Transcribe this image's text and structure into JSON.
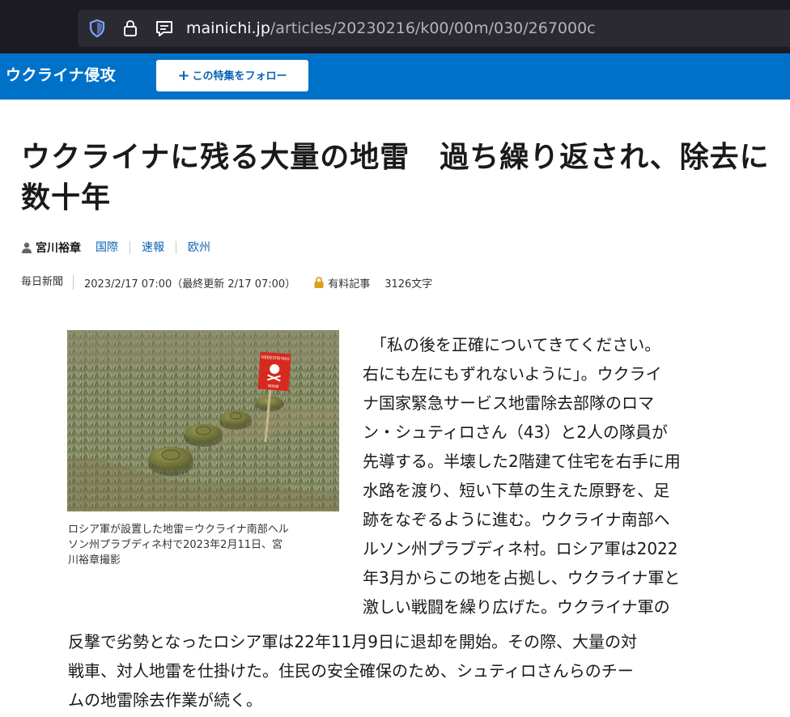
{
  "browser": {
    "url_domain": "mainichi.jp",
    "url_path": "/articles/20230216/k00/00m/030/267000c",
    "icons": [
      "shield-icon",
      "lock-icon",
      "reader-view-icon"
    ]
  },
  "section": {
    "title": "ウクライナ侵攻",
    "follow_label": "この特集をフォロー",
    "color": "#0071c9"
  },
  "article": {
    "headline": "ウクライナに残る大量の地雷　過ち繰り返され、除去に数十年",
    "author": "宮川裕章",
    "tags": [
      "国際",
      "速報",
      "欧州"
    ],
    "source": "毎日新聞",
    "date": "2023/2/17 07:00（最終更新 2/17 07:00）",
    "paid_label": "有料記事",
    "char_count": "3126文字",
    "photo_sign_text": "НЕБЕЗПЕЧНО\nМІНИ",
    "caption_lines": [
      "ロシア軍が設置した地雷＝ウクライナ南部ヘル",
      "ソン州プラブディネ村で2023年2月11日、宮",
      "川裕章撮影"
    ],
    "body_lines": [
      "　「私の後を正確についてきてください。",
      "右にも左にもずれないように」。ウクライ",
      "ナ国家緊急サービス地雷除去部隊のロマ",
      "ン・シュティロさん（43）と2人の隊員が",
      "先導する。半壊した2階建て住宅を右手に用",
      "水路を渡り、短い下草の生えた原野を、足",
      "跡をなぞるように進む。ウクライナ南部ヘ",
      "ルソン州プラブディネ村。ロシア軍は2022",
      "年3月からこの地を占拠し、ウクライナ軍と",
      "激しい戦闘を繰り広げた。ウクライナ軍の"
    ],
    "body_wide_lines": [
      "反撃で劣勢となったロシア軍は22年11月9日に退却を開始。その際、大量の対",
      "戦車、対人地雷を仕掛けた。住民の安全確保のため、シュティロさんらのチー",
      "ムの地雷除去作業が続く。"
    ]
  }
}
